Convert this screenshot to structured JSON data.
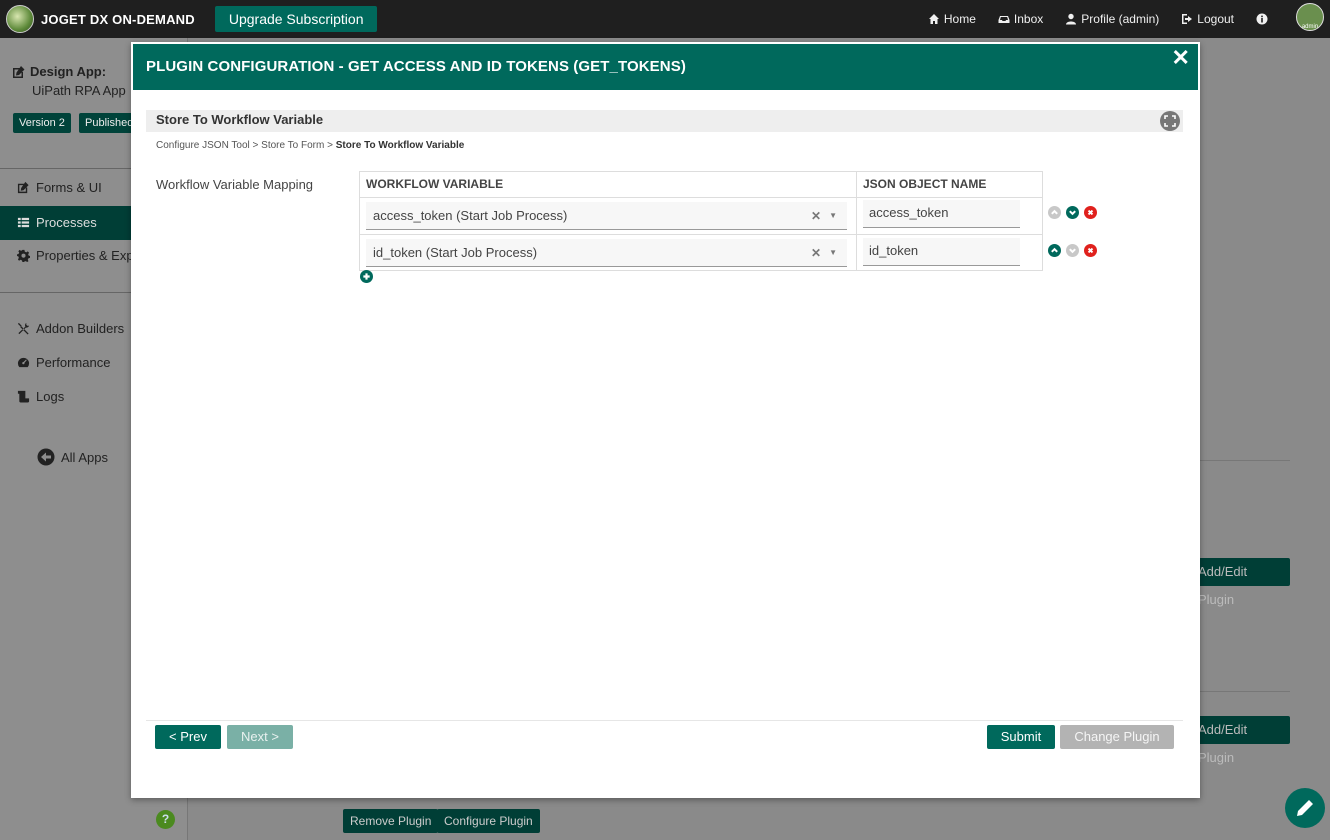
{
  "topbar": {
    "brand": "JOGET DX ON-DEMAND",
    "upgrade": "Upgrade Subscription",
    "nav": {
      "home": "Home",
      "inbox": "Inbox",
      "profile": "Profile (admin)",
      "logout": "Logout"
    },
    "avatar_text": "admin"
  },
  "sidebar": {
    "design_label": "Design App:",
    "app_name": "UiPath RPA App",
    "version_badge": "Version 2",
    "published_badge": "Published",
    "items": [
      {
        "label": "Forms & UI",
        "icon": "edit-icon"
      },
      {
        "label": "Processes",
        "icon": "list-icon"
      },
      {
        "label": "Properties & Export",
        "icon": "gear-icon"
      },
      {
        "label": "Addon Builders",
        "icon": "tools-icon"
      },
      {
        "label": "Performance",
        "icon": "gauge-icon"
      },
      {
        "label": "Logs",
        "icon": "logs-icon"
      }
    ],
    "all_apps": "All Apps"
  },
  "background": {
    "add_edit_plugin_1": "Add/Edit Plugin",
    "add_edit_plugin_2": "Add/Edit Plugin",
    "remove_plugin": "Remove Plugin",
    "configure_plugin": "Configure Plugin"
  },
  "modal": {
    "title": "PLUGIN CONFIGURATION - GET ACCESS AND ID TOKENS (GET_TOKENS)",
    "section_title": "Store To Workflow Variable",
    "breadcrumb": [
      "Configure JSON Tool",
      "Store To Form",
      "Store To Workflow Variable"
    ],
    "breadcrumb_sep": ">",
    "field_label": "Workflow Variable Mapping",
    "grid": {
      "columns": [
        "WORKFLOW VARIABLE",
        "JSON OBJECT NAME"
      ],
      "rows": [
        {
          "workflow_variable": "access_token (Start Job Process)",
          "json_object_name": "access_token"
        },
        {
          "workflow_variable": "id_token (Start Job Process)",
          "json_object_name": "id_token"
        }
      ]
    },
    "buttons": {
      "prev": "< Prev",
      "next": "Next >",
      "submit": "Submit",
      "change_plugin": "Change Plugin"
    }
  },
  "colors": {
    "primary": "#00695c",
    "danger": "#e0211d",
    "topbar": "#1f1f1f"
  }
}
